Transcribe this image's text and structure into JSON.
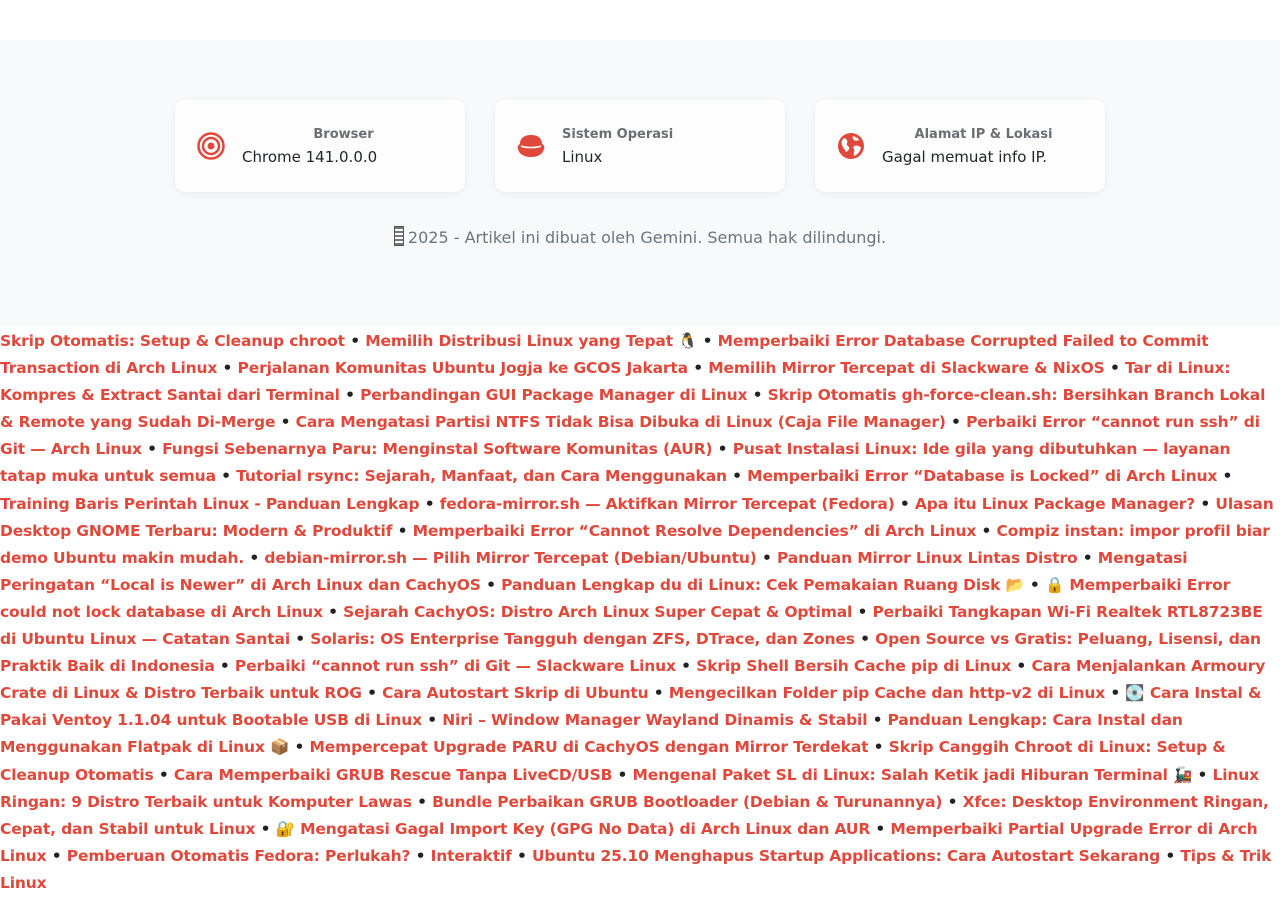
{
  "cards": {
    "browser": {
      "label": "Browser",
      "value": "Chrome 141.0.0.0",
      "icon": "target-icon"
    },
    "os": {
      "label": "Sistem Operasi",
      "value": "Linux",
      "icon": "os-logo-icon"
    },
    "ip": {
      "label": "Alamat IP & Lokasi",
      "value": "Gagal memuat info IP.",
      "icon": "globe-icon"
    }
  },
  "copyright": "2025 - Artikel ini dibuat oleh Gemini. Semua hak dilindungi.",
  "accent_color": "#e0483b",
  "separator": "•",
  "links": [
    "Skrip Otomatis: Setup & Cleanup chroot",
    "Memilih Distribusi Linux yang Tepat 🐧",
    "Memperbaiki Error Database Corrupted Failed to Commit Transaction di Arch Linux",
    "Perjalanan Komunitas Ubuntu Jogja ke GCOS Jakarta",
    "Memilih Mirror Tercepat di Slackware & NixOS",
    "Tar di Linux: Kompres & Extract Santai dari Terminal",
    "Perbandingan GUI Package Manager di Linux",
    "Skrip Otomatis gh-force-clean.sh: Bersihkan Branch Lokal & Remote yang Sudah Di-Merge",
    "Cara Mengatasi Partisi NTFS Tidak Bisa Dibuka di Linux (Caja File Manager)",
    "Perbaiki Error “cannot run ssh” di Git — Arch Linux",
    "Fungsi Sebenarnya Paru: Menginstal Software Komunitas (AUR)",
    "Pusat Instalasi Linux: Ide gila yang dibutuhkan — layanan tatap muka untuk semua",
    "Tutorial rsync: Sejarah, Manfaat, dan Cara Menggunakan",
    "Memperbaiki Error “Database is Locked” di Arch Linux",
    "Training Baris Perintah Linux - Panduan Lengkap",
    "fedora-mirror.sh — Aktifkan Mirror Tercepat (Fedora)",
    "Apa itu Linux Package Manager?",
    "Ulasan Desktop GNOME Terbaru: Modern & Produktif",
    "Memperbaiki Error “Cannot Resolve Dependencies” di Arch Linux",
    "Compiz instan: impor profil biar demo Ubuntu makin mudah.",
    "debian-mirror.sh — Pilih Mirror Tercepat (Debian/Ubuntu)",
    "Panduan Mirror Linux Lintas Distro",
    "Mengatasi Peringatan “Local is Newer” di Arch Linux dan CachyOS",
    "Panduan Lengkap du di Linux: Cek Pemakaian Ruang Disk 📂",
    "🔒 Memperbaiki Error could not lock database di Arch Linux",
    "Sejarah CachyOS: Distro Arch Linux Super Cepat & Optimal",
    "Perbaiki Tangkapan Wi-Fi Realtek RTL8723BE di Ubuntu Linux — Catatan Santai",
    "Solaris: OS Enterprise Tangguh dengan ZFS, DTrace, dan Zones",
    "Open Source vs Gratis: Peluang, Lisensi, dan Praktik Baik di Indonesia",
    "Perbaiki “cannot run ssh” di Git — Slackware Linux",
    "Skrip Shell Bersih Cache pip di Linux",
    "Cara Menjalankan Armoury Crate di Linux & Distro Terbaik untuk ROG",
    "Cara Autostart Skrip di Ubuntu",
    "Mengecilkan Folder pip Cache dan http-v2 di Linux",
    "💽 Cara Instal & Pakai Ventoy 1.1.04 untuk Bootable USB di Linux",
    "Niri – Window Manager Wayland Dinamis & Stabil",
    "Panduan Lengkap: Cara Instal dan Menggunakan Flatpak di Linux 📦",
    "Mempercepat Upgrade PARU di CachyOS dengan Mirror Terdekat",
    "Skrip Canggih Chroot di Linux: Setup & Cleanup Otomatis",
    "Cara Memperbaiki GRUB Rescue Tanpa LiveCD/USB",
    "Mengenal Paket SL di Linux: Salah Ketik jadi Hiburan Terminal 🚂",
    "Linux Ringan: 9 Distro Terbaik untuk Komputer Lawas",
    "Bundle Perbaikan GRUB Bootloader (Debian & Turunannya)",
    "Xfce: Desktop Environment Ringan, Cepat, dan Stabil untuk Linux",
    "🔐 Mengatasi Gagal Import Key (GPG No Data) di Arch Linux dan AUR",
    "Memperbaiki Partial Upgrade Error di Arch Linux",
    "Pemberuan Otomatis Fedora: Perlukah?",
    "Interaktif",
    "Ubuntu 25.10 Menghapus Startup Applications: Cara Autostart Sekarang",
    "Tips & Trik Linux"
  ]
}
